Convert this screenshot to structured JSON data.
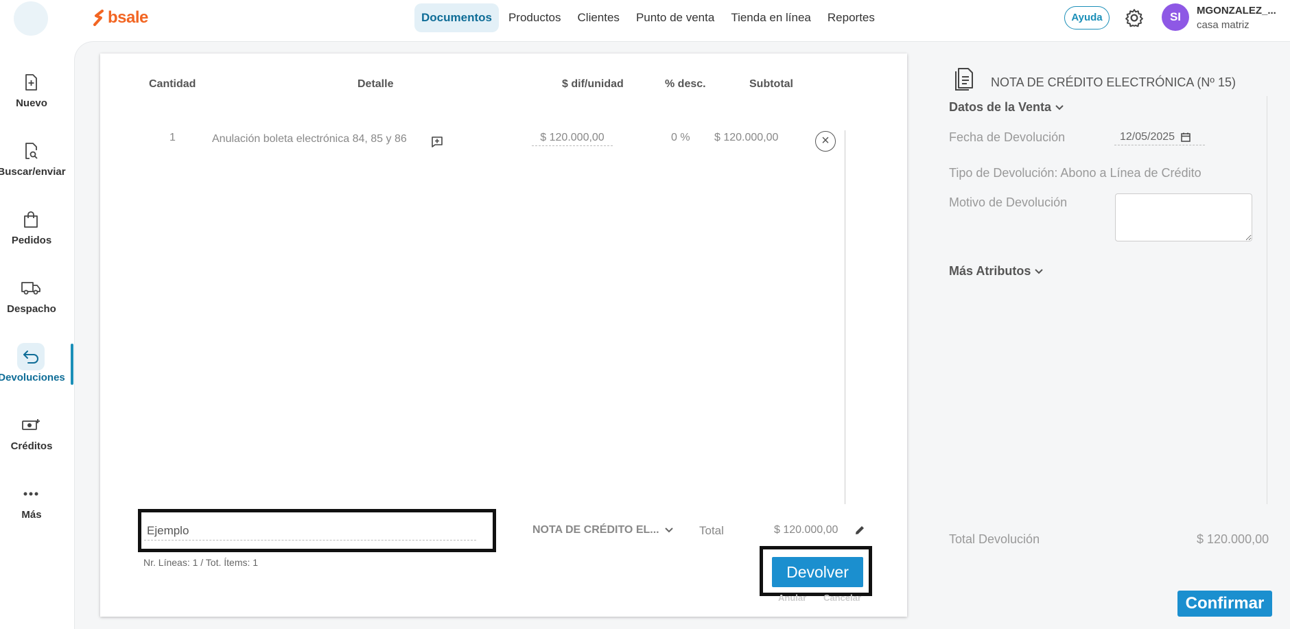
{
  "header": {
    "brand": "bsale",
    "nav": [
      {
        "label": "Documentos",
        "active": true
      },
      {
        "label": "Productos"
      },
      {
        "label": "Clientes"
      },
      {
        "label": "Punto de venta"
      },
      {
        "label": "Tienda en línea"
      },
      {
        "label": "Reportes"
      }
    ],
    "help_label": "Ayuda",
    "avatar_initials": "SI",
    "user_name": "MGONZALEZ_...",
    "branch": "casa matriz"
  },
  "sidebar": {
    "items": [
      {
        "label": "Nuevo",
        "icon": "file-plus-icon"
      },
      {
        "label": "Buscar/enviar",
        "icon": "file-search-icon"
      },
      {
        "label": "Pedidos",
        "icon": "shopping-bag-icon"
      },
      {
        "label": "Despacho",
        "icon": "truck-icon"
      },
      {
        "label": "Devoluciones",
        "icon": "return-arrow-icon",
        "active": true
      },
      {
        "label": "Créditos",
        "icon": "money-plus-icon"
      },
      {
        "label": "Más",
        "icon": "more-dots-icon"
      }
    ]
  },
  "table": {
    "headers": {
      "quantity": "Cantidad",
      "detail": "Detalle",
      "unit_price": "$ dif/unidad",
      "discount": "% desc.",
      "subtotal": "Subtotal"
    },
    "rows": [
      {
        "quantity": "1",
        "detail": "Anulación boleta electrónica 84, 85 y 86",
        "unit_price": "$ 120.000,00",
        "discount": "0 %",
        "subtotal": "$ 120.000,00"
      }
    ]
  },
  "footer": {
    "comment_value": "Ejemplo",
    "line_info": "Nr. Líneas: 1 / Tot. Ítems: 1",
    "doc_type": "NOTA DE CRÉDITO EL...",
    "total_label": "Total",
    "total_value": "$ 120.000,00",
    "return_label": "Devolver",
    "cancel_link": "Anular",
    "discard_link": "Cancelar"
  },
  "panel": {
    "title": "NOTA DE CRÉDITO ELECTRÓNICA (Nº 15)",
    "sale_data_label": "Datos de la Venta",
    "return_date_label": "Fecha de Devolución",
    "return_date_value": "12/05/2025",
    "return_type": "Tipo de Devolución: Abono a Línea de Crédito",
    "return_reason_label": "Motivo de Devolución",
    "more_attrs_label": "Más Atributos",
    "total_return_label": "Total Devolución",
    "total_return_value": "$ 120.000,00",
    "confirm_label": "Confirmar"
  },
  "colors": {
    "accent": "#1b8fcf",
    "brand": "#f26522",
    "avatar": "#8e58e5"
  }
}
